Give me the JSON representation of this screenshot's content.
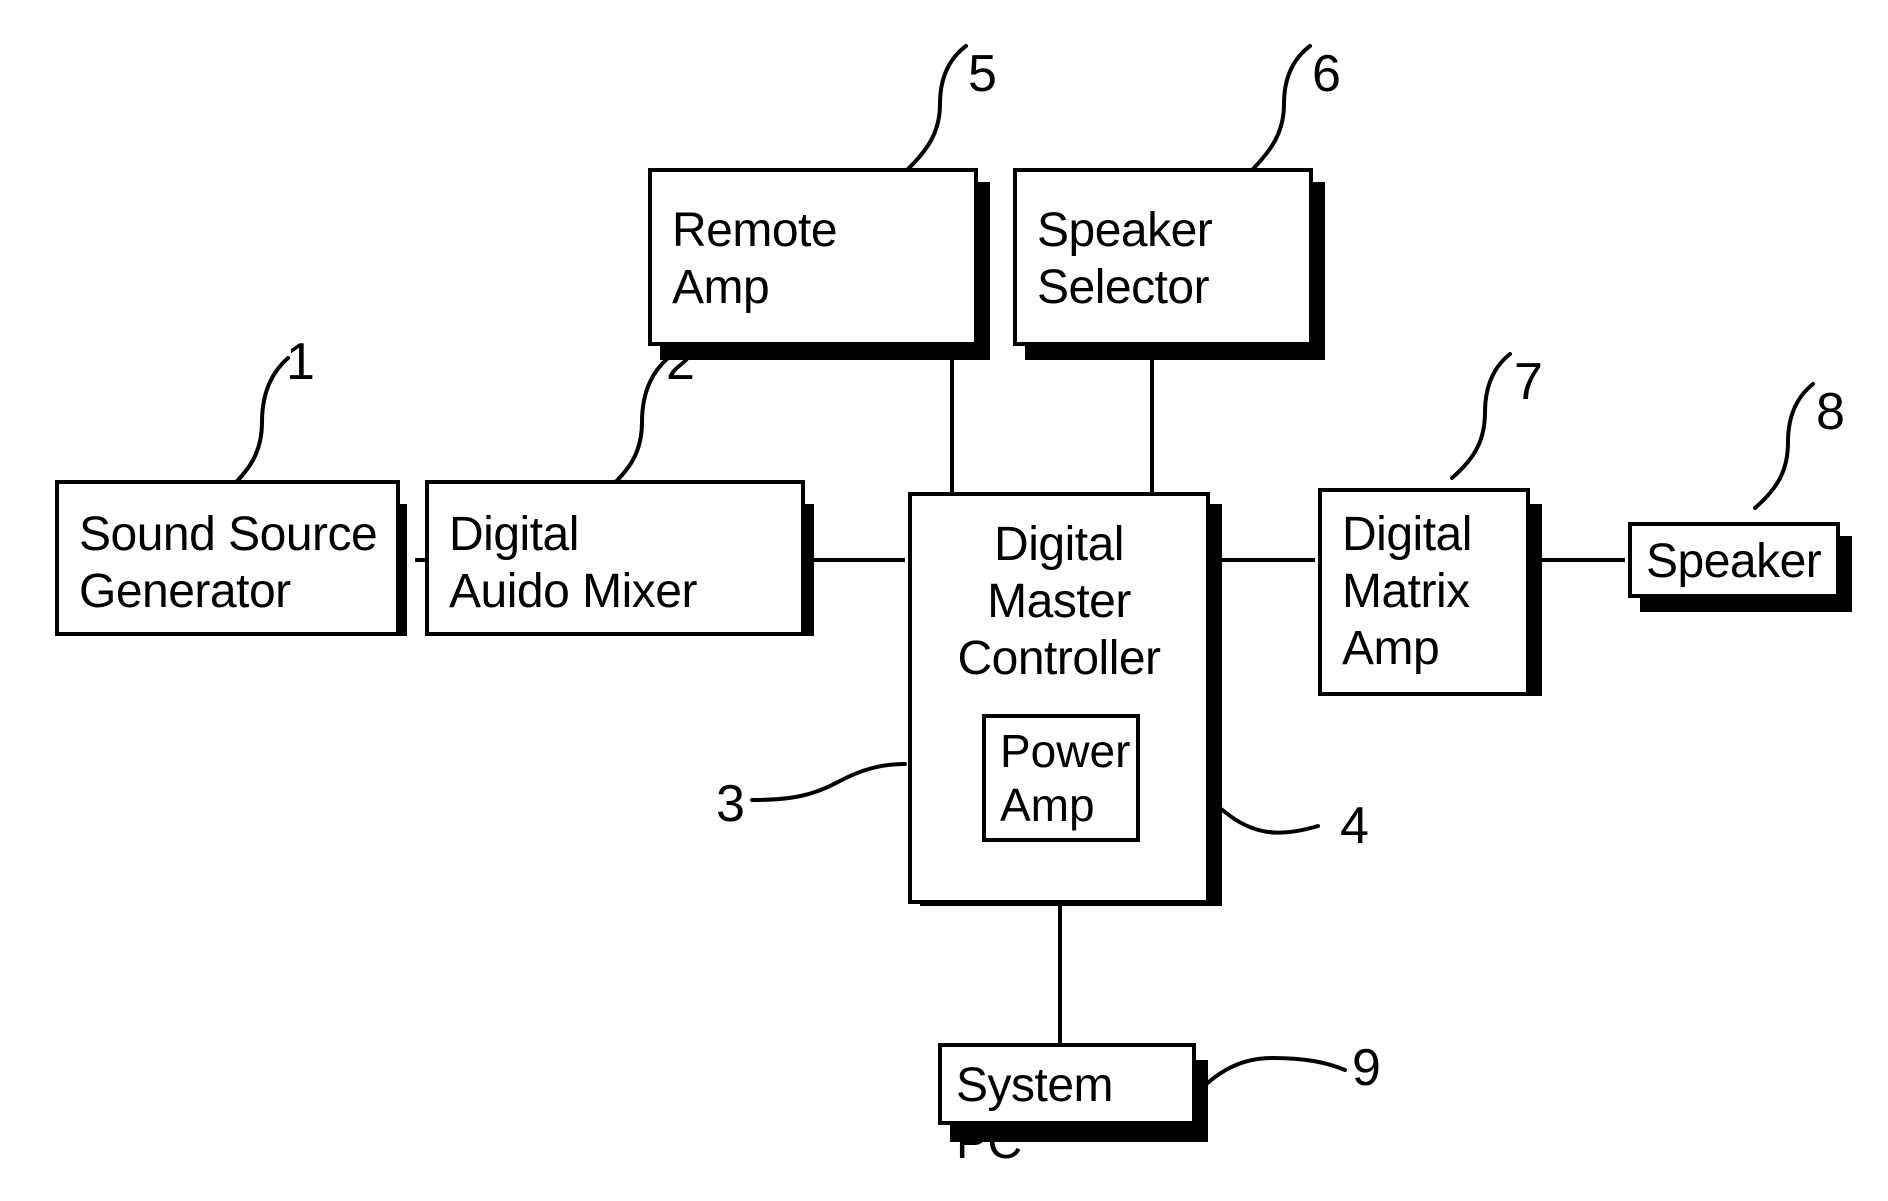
{
  "figure": {
    "type": "patent-block-diagram",
    "background_color": "#ffffff",
    "line_color": "#000000"
  },
  "nodes": [
    {
      "id": "sound-source-generator",
      "label": "Sound Source\nGenerator",
      "ref": "1"
    },
    {
      "id": "digital-audio-mixer",
      "label": "Digital\nAuido Mixer",
      "ref": "2"
    },
    {
      "id": "digital-master-controller",
      "label": "Digital\nMaster\nController",
      "ref": "3"
    },
    {
      "id": "power-amp",
      "label": "Power\nAmp",
      "ref": "4"
    },
    {
      "id": "remote-amp",
      "label": "Remote\nAmp",
      "ref": "5"
    },
    {
      "id": "speaker-selector",
      "label": "Speaker\nSelector",
      "ref": "6"
    },
    {
      "id": "digital-matrix-amp",
      "label": "Digital\nMatrix\nAmp",
      "ref": "7"
    },
    {
      "id": "speaker",
      "label": "Speaker",
      "ref": "8"
    },
    {
      "id": "system-pc",
      "label": "System PC",
      "ref": "9"
    }
  ],
  "reference_numerals": {
    "n1": "1",
    "n2": "2",
    "n3": "3",
    "n4": "4",
    "n5": "5",
    "n6": "6",
    "n7": "7",
    "n8": "8",
    "n9": "9"
  },
  "labels": {
    "sound_source_generator": "Sound Source\nGenerator",
    "digital_audio_mixer": "Digital\nAuido Mixer",
    "digital_master_controller": "Digital\nMaster\nController",
    "power_amp": "Power\nAmp",
    "remote_amp": "Remote\nAmp",
    "speaker_selector": "Speaker\nSelector",
    "digital_matrix_amp": "Digital\nMatrix\nAmp",
    "speaker": "Speaker",
    "system_pc": "System PC"
  },
  "connections": [
    {
      "from": "sound-source-generator",
      "to": "digital-audio-mixer"
    },
    {
      "from": "digital-audio-mixer",
      "to": "digital-master-controller"
    },
    {
      "from": "remote-amp",
      "to": "digital-master-controller"
    },
    {
      "from": "speaker-selector",
      "to": "digital-master-controller"
    },
    {
      "from": "digital-master-controller",
      "to": "digital-matrix-amp"
    },
    {
      "from": "digital-matrix-amp",
      "to": "speaker"
    },
    {
      "from": "digital-master-controller",
      "to": "system-pc"
    }
  ]
}
